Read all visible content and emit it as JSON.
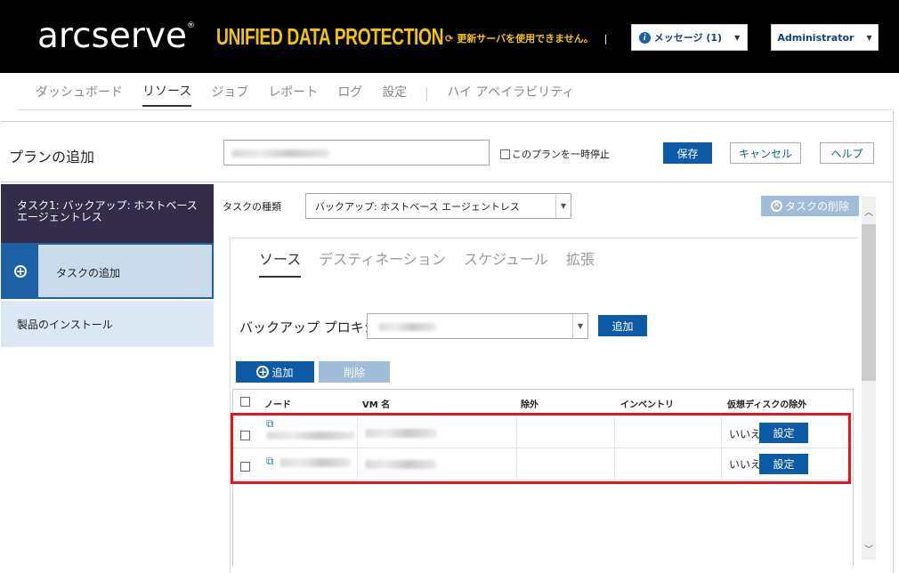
{
  "header": {
    "logo": "arcserve",
    "product": "UNIFIED DATA PROTECTION",
    "update_message": "更新サーバを使用できません。",
    "separator": "|",
    "messages_label": "メッセージ (1)",
    "user_label": "Administrator",
    "colors": {
      "background": "#000000",
      "accent": "#f2c500"
    }
  },
  "nav": {
    "items": [
      "ダッシュボード",
      "リソース",
      "ジョブ",
      "レポート",
      "ログ",
      "設定"
    ],
    "active": "リソース",
    "extra": "ハイ アベイラビリティ"
  },
  "plan": {
    "title": "プランの追加",
    "name_value": "",
    "pause_label": "このプランを一時停止",
    "save": "保存",
    "cancel": "キャンセル",
    "help": "ヘルプ"
  },
  "sidebar": {
    "task": "タスク1: バックアップ: ホストベース エージェントレス",
    "add_task": "タスクの追加",
    "install": "製品のインストール"
  },
  "task": {
    "type_label": "タスクの種類",
    "type_value": "バックアップ: ホストベース エージェントレス",
    "delete_label": "タスクの削除"
  },
  "tabs": {
    "items": [
      "ソース",
      "デスティネーション",
      "スケジュール",
      "拡張"
    ],
    "active": "ソース"
  },
  "source": {
    "proxy_label": "バックアップ プロキシ",
    "proxy_add": "追加",
    "add_button": "追加",
    "delete_button": "削除"
  },
  "grid": {
    "columns": [
      "ノード",
      "VM 名",
      "除外",
      "インベントリ",
      "仮想ディスクの除外"
    ],
    "rows": [
      {
        "exclude_disk": "いいえ",
        "action": "設定"
      },
      {
        "exclude_disk": "いいえ",
        "action": "設定"
      }
    ]
  },
  "icons": [
    "refresh-icon",
    "info-icon",
    "plus-circle-icon",
    "x-circle-icon",
    "vm-icon",
    "chevron-down-icon",
    "chevron-up-icon"
  ]
}
